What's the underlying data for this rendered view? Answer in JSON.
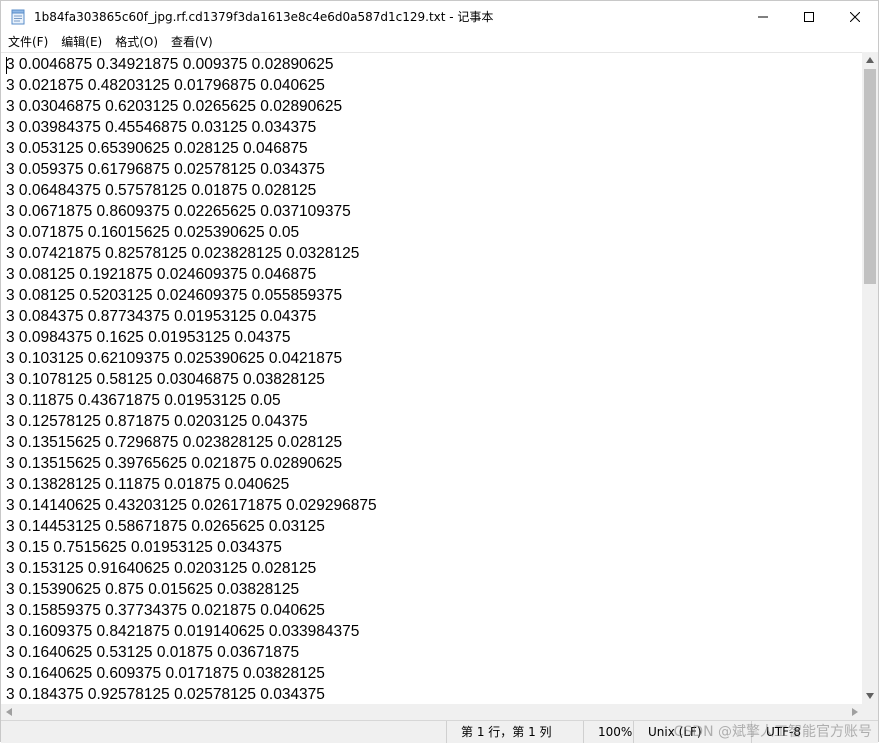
{
  "window": {
    "title": "1b84fa303865c60f_jpg.rf.cd1379f3da1613e8c4e6d0a587d1c129.txt - 记事本",
    "app_icon": "notepad-icon",
    "controls": [
      "minimize-icon",
      "maximize-icon",
      "close-icon"
    ]
  },
  "menu": {
    "file": "文件(F)",
    "edit": "编辑(E)",
    "format": "格式(O)",
    "view": "查看(V)"
  },
  "document": {
    "lines": [
      "3 0.0046875 0.34921875 0.009375 0.02890625",
      "3 0.021875 0.48203125 0.01796875 0.040625",
      "3 0.03046875 0.6203125 0.0265625 0.02890625",
      "3 0.03984375 0.45546875 0.03125 0.034375",
      "3 0.053125 0.65390625 0.028125 0.046875",
      "3 0.059375 0.61796875 0.02578125 0.034375",
      "3 0.06484375 0.57578125 0.01875 0.028125",
      "3 0.0671875 0.8609375 0.02265625 0.037109375",
      "3 0.071875 0.16015625 0.025390625 0.05",
      "3 0.07421875 0.82578125 0.023828125 0.0328125",
      "3 0.08125 0.1921875 0.024609375 0.046875",
      "3 0.08125 0.5203125 0.024609375 0.055859375",
      "3 0.084375 0.87734375 0.01953125 0.04375",
      "3 0.0984375 0.1625 0.01953125 0.04375",
      "3 0.103125 0.62109375 0.025390625 0.0421875",
      "3 0.1078125 0.58125 0.03046875 0.03828125",
      "3 0.11875 0.43671875 0.01953125 0.05",
      "3 0.12578125 0.871875 0.0203125 0.04375",
      "3 0.13515625 0.7296875 0.023828125 0.028125",
      "3 0.13515625 0.39765625 0.021875 0.02890625",
      "3 0.13828125 0.11875 0.01875 0.040625",
      "3 0.14140625 0.43203125 0.026171875 0.029296875",
      "3 0.14453125 0.58671875 0.0265625 0.03125",
      "3 0.15 0.7515625 0.01953125 0.034375",
      "3 0.153125 0.91640625 0.0203125 0.028125",
      "3 0.15390625 0.875 0.015625 0.03828125",
      "3 0.15859375 0.37734375 0.021875 0.040625",
      "3 0.1609375 0.8421875 0.019140625 0.033984375",
      "3 0.1640625 0.53125 0.01875 0.03671875",
      "3 0.1640625 0.609375 0.0171875 0.03828125",
      "3 0.184375 0.92578125 0.02578125 0.034375"
    ]
  },
  "status": {
    "position": "第 1 行，第 1 列",
    "zoom": "100%",
    "line_ending": "Unix (LF)",
    "encoding": "UTF-8",
    "watermark": "CSDN @斌擎人工智能官方账号"
  }
}
